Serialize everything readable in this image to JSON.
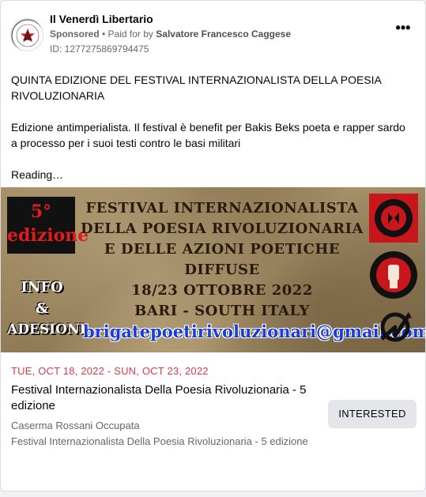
{
  "header": {
    "page_name": "Il Venerdì Libertario",
    "sponsored": "Sponsored",
    "paid_prefix": "• Paid for by",
    "payer": "Salvatore Francesco Caggese",
    "ad_id": "ID: 1277275869794475",
    "more_label": "•••"
  },
  "post": {
    "line1": "QUINTA EDIZIONE DEL FESTIVAL INTERNAZIONALISTA DELLA POESIA RIVOLUZIONARIA",
    "line2": "Edizione antimperialista. Il festival è benefit per Bakis Beks poeta e rapper sardo a processo per i suoi testi contro le basi militari",
    "line3": "Reading…"
  },
  "banner": {
    "badge_number": "5°",
    "badge_word": "edizione",
    "title_lines": [
      "FESTIVAL INTERNAZIONALISTA",
      "DELLA POESIA RIVOLUZIONARIA",
      "E DELLE AZIONI POETICHE DIFFUSE",
      "18/23 OTTOBRE 2022",
      "BARI - SOUTH ITALY"
    ],
    "info": "INFO",
    "amp": "&",
    "adesioni": "ADESIONI",
    "email": "brigatepoetirivoluzionari@gmail.com"
  },
  "event": {
    "date": "TUE, OCT 18, 2022 - SUN, OCT 23, 2022",
    "title": "Festival Internazionalista Della Poesia Rivoluzionaria - 5 edizione",
    "venue": "Caserma Rossani Occupata",
    "description": "Festival Internazionalista Della Poesia Rivoluzionaria - 5 edizione",
    "button": "INTERESTED"
  },
  "colors": {
    "date_red": "#d83b4b",
    "email_blue": "#1a3cd8",
    "button_bg": "#e4e6eb"
  }
}
